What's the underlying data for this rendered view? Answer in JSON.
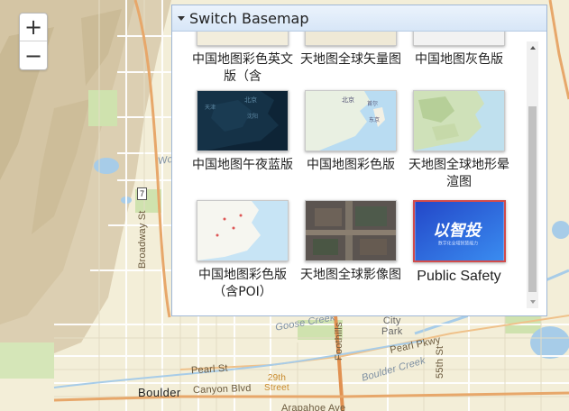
{
  "map": {
    "labels": {
      "boulder": "Boulder",
      "broadway": "Broadway St",
      "pearl_st": "Pearl St",
      "canyon_blvd": "Canyon Blvd",
      "street29_a": "29th",
      "street29_b": "Street",
      "arapahoe": "Arapahoe Ave",
      "goose_creek": "Goose Creek",
      "boulder_creek": "Boulder Creek",
      "city_park_a": "City",
      "city_park_b": "Park",
      "pearl_pkwy": "Pearl Pkwy",
      "foothills": "Foothills",
      "st55": "55th St",
      "wo": "Wo",
      "shield7": "7"
    },
    "colors": {
      "land": "#f3eed8",
      "terrain": "#d9cdb0",
      "water": "#a7cce8",
      "park": "#cfe3b0",
      "major_road": "#e9a262",
      "road": "#ffffff"
    }
  },
  "zoom": {
    "in_label": "+",
    "out_label": "−"
  },
  "basemap": {
    "title": "Switch Basemap",
    "items": [
      {
        "label": "中国地图彩色英文版（含",
        "icon": "map-thumb-english",
        "selected": false
      },
      {
        "label": "天地图全球矢量图",
        "icon": "map-thumb-vector",
        "selected": false
      },
      {
        "label": "中国地图灰色版",
        "icon": "map-thumb-gray",
        "selected": false
      },
      {
        "label": "中国地图午夜蓝版",
        "icon": "map-thumb-midnight",
        "selected": false,
        "text": {
          "a": "北京",
          "b": "天津",
          "c": "沈阳"
        }
      },
      {
        "label": "中国地图彩色版",
        "icon": "map-thumb-color",
        "selected": false,
        "text": {
          "a": "北京",
          "b": "首尔",
          "c": "东京"
        }
      },
      {
        "label": "天地图全球地形晕渲图",
        "icon": "map-thumb-terrain",
        "selected": false
      },
      {
        "label": "中国地图彩色版（含POI）",
        "icon": "map-thumb-poi",
        "selected": false
      },
      {
        "label": "天地图全球影像图",
        "icon": "map-thumb-imagery",
        "selected": false
      },
      {
        "label": "Public Safety",
        "icon": "map-thumb-public-safety",
        "selected": true,
        "text": {
          "a": "以智投",
          "b": "数字化全域智慧能力"
        }
      }
    ]
  }
}
